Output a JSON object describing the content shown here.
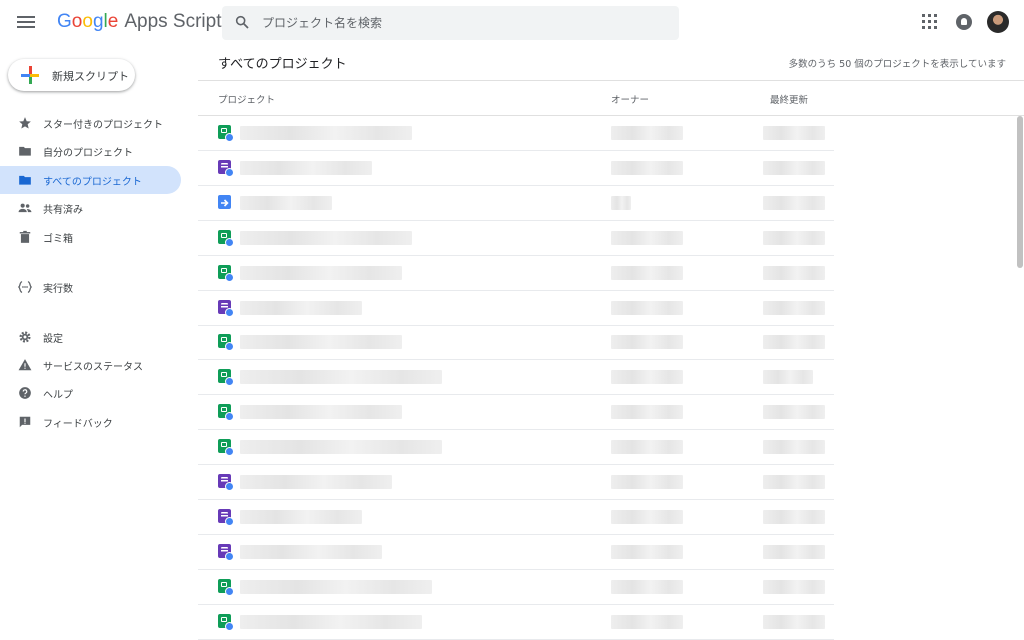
{
  "app": {
    "logo_parts": [
      "G",
      "o",
      "o",
      "g",
      "l",
      "e"
    ],
    "product": "Apps Script"
  },
  "search": {
    "placeholder": "プロジェクト名を検索"
  },
  "new_button": {
    "label": "新規スクリプト"
  },
  "sidebar": {
    "items": [
      {
        "label": "スター付きのプロジェクト",
        "icon": "star-icon"
      },
      {
        "label": "自分のプロジェクト",
        "icon": "folder-icon"
      },
      {
        "label": "すべてのプロジェクト",
        "icon": "folder-icon",
        "active": true
      },
      {
        "label": "共有済み",
        "icon": "people-icon"
      },
      {
        "label": "ゴミ箱",
        "icon": "trash-icon"
      },
      {
        "label": "実行数",
        "icon": "executions-icon"
      },
      {
        "label": "設定",
        "icon": "gear-icon"
      },
      {
        "label": "サービスのステータス",
        "icon": "warning-icon"
      },
      {
        "label": "ヘルプ",
        "icon": "help-icon"
      },
      {
        "label": "フィードバック",
        "icon": "feedback-icon"
      }
    ]
  },
  "main": {
    "title": "すべてのプロジェクト",
    "count_text": "多数のうち 50 個のプロジェクトを表示しています",
    "columns": {
      "project": "プロジェクト",
      "owner": "オーナー",
      "modified": "最終更新"
    },
    "rows": [
      {
        "type": "sheet"
      },
      {
        "type": "form"
      },
      {
        "type": "arrow"
      },
      {
        "type": "sheet"
      },
      {
        "type": "sheet"
      },
      {
        "type": "form"
      },
      {
        "type": "sheet"
      },
      {
        "type": "sheet"
      },
      {
        "type": "sheet"
      },
      {
        "type": "sheet"
      },
      {
        "type": "form"
      },
      {
        "type": "form"
      },
      {
        "type": "form"
      },
      {
        "type": "sheet"
      },
      {
        "type": "sheet"
      }
    ]
  },
  "colors": {
    "active_bg": "#d2e3fc",
    "active_text": "#1967d2",
    "sheet": "#0f9d58",
    "form": "#673ab7",
    "script": "#4285f4"
  }
}
